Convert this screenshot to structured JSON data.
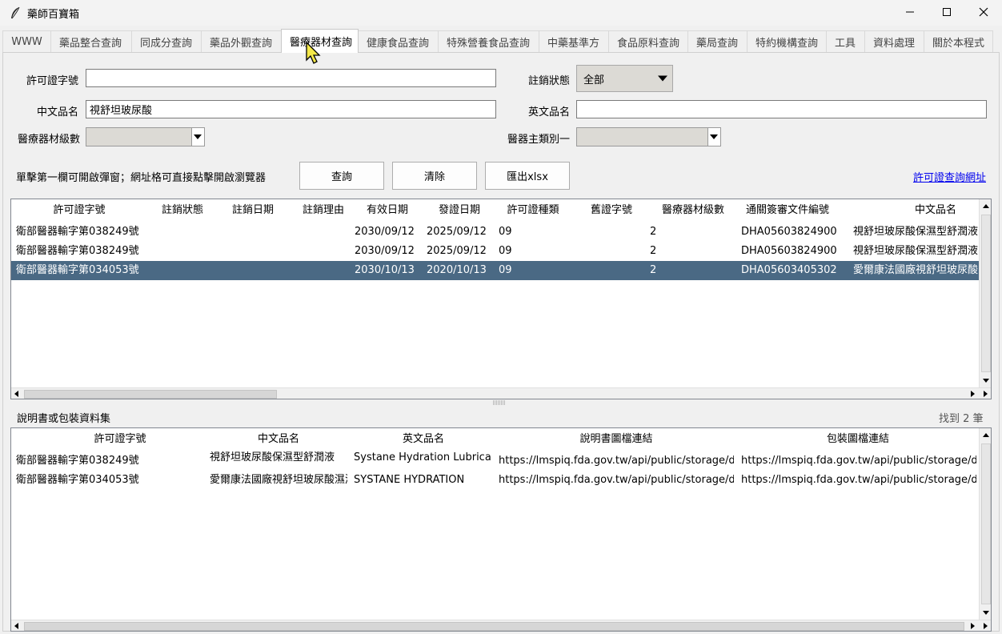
{
  "window": {
    "title": "藥師百寶箱"
  },
  "tabs": [
    {
      "label": "WWW"
    },
    {
      "label": "藥品整合查詢"
    },
    {
      "label": "同成分查詢"
    },
    {
      "label": "藥品外觀查詢"
    },
    {
      "label": "醫療器材查詢"
    },
    {
      "label": "健康食品查詢"
    },
    {
      "label": "特殊營養食品查詢"
    },
    {
      "label": "中藥基準方"
    },
    {
      "label": "食品原料查詢"
    },
    {
      "label": "藥局查詢"
    },
    {
      "label": "特約機構查詢"
    },
    {
      "label": "工具"
    },
    {
      "label": "資料處理"
    },
    {
      "label": "關於本程式"
    }
  ],
  "form": {
    "license_label": "許可證字號",
    "license_value": "",
    "status_label": "註銷狀態",
    "status_value": "全部",
    "cname_label": "中文品名",
    "cname_value": "視舒坦玻尿酸",
    "ename_label": "英文品名",
    "ename_value": "",
    "class_label": "醫療器材級數",
    "class_value": "",
    "category_label": "醫器主類別一",
    "category_value": ""
  },
  "actions": {
    "hint": "單擊第一欄可開啟彈窗；網址格可直接點擊開啟瀏覽器",
    "query": "查詢",
    "clear": "清除",
    "export": "匯出xlsx",
    "link": "許可證查詢網址"
  },
  "results": {
    "columns": [
      "許可證字號",
      "註銷狀態",
      "註銷日期",
      "註銷理由",
      "有效日期",
      "發證日期",
      "許可證種類",
      "舊證字號",
      "醫療器材級數",
      "通關簽審文件編號",
      "中文品名"
    ],
    "rows": [
      [
        "衛部醫器輸字第038249號",
        "",
        "",
        "",
        "2030/09/12",
        "2025/09/12",
        "09",
        "",
        "2",
        "DHA05603824900",
        "視舒坦玻尿酸保濕型舒潤液"
      ],
      [
        "衛部醫器輸字第038249號",
        "",
        "",
        "",
        "2030/09/12",
        "2025/09/12",
        "09",
        "",
        "2",
        "DHA05603824900",
        "視舒坦玻尿酸保濕型舒潤液"
      ],
      [
        "衛部醫器輸字第034053號",
        "",
        "",
        "",
        "2030/10/13",
        "2020/10/13",
        "09",
        "",
        "2",
        "DHA05603405302",
        "愛爾康法國廠視舒坦玻尿酸"
      ]
    ],
    "selected_index": 2
  },
  "docs": {
    "title": "說明書或包裝資料集",
    "count": "找到 2 筆",
    "columns": [
      "許可證字號",
      "中文品名",
      "英文品名",
      "說明書圖檔連結",
      "包裝圖檔連結"
    ],
    "rows": [
      [
        "衛部醫器輸字第038249號",
        "視舒坦玻尿酸保濕型舒潤液",
        "Systane Hydration Lubricant",
        "https://lmspiq.fda.gov.tw/api/public/storage/dow",
        "https://lmspiq.fda.gov.tw/api/public/storage/dow"
      ],
      [
        "衛部醫器輸字第034053號",
        "愛爾康法國廠視舒坦玻尿酸濕潤",
        "SYSTANE HYDRATION",
        "https://lmspiq.fda.gov.tw/api/public/storage/dow",
        "https://lmspiq.fda.gov.tw/api/public/storage/dow"
      ]
    ]
  },
  "colors": {
    "selection": "#4a6984",
    "link": "#0000ee"
  }
}
